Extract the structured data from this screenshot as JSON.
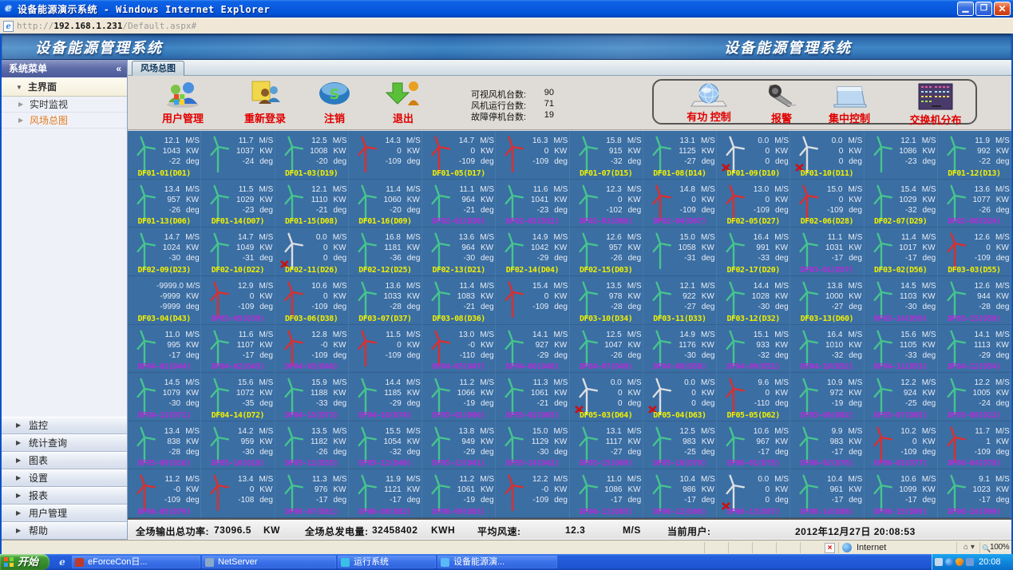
{
  "window": {
    "title": "设备能源演示系统 - Windows Internet Explorer",
    "url_prefix": "http://",
    "url_host": "192.168.1.231",
    "url_path": "/Default.aspx#",
    "minimize": "_",
    "restore": "❐",
    "close": "✕"
  },
  "banner": {
    "left_title": "设备能源管理系统",
    "right_title": "设备能源管理系统"
  },
  "sidebar": {
    "header": "系统菜单",
    "collapse": "«",
    "main_item": "主界面",
    "sub_items": [
      {
        "label": "实时监视",
        "highlight": false
      },
      {
        "label": "风场总图",
        "highlight": true
      }
    ],
    "accordion": [
      "监控",
      "统计查询",
      "图表",
      "设置",
      "报表",
      "用户管理",
      "帮助"
    ]
  },
  "tab": "风场总图",
  "toolbar": {
    "buttons": [
      {
        "label": "用户管理",
        "icon": "users"
      },
      {
        "label": "重新登录",
        "icon": "relogin"
      },
      {
        "label": "注销",
        "icon": "logout"
      },
      {
        "label": "退出",
        "icon": "exit"
      }
    ],
    "stats": [
      {
        "label": "可视风机台数:",
        "value": "90"
      },
      {
        "label": "风机运行台数:",
        "value": "71"
      },
      {
        "label": "故障停机台数:",
        "value": "19"
      }
    ],
    "controls": [
      {
        "label": "有功 控制",
        "icon": "globe"
      },
      {
        "label": "报警",
        "icon": "speaker"
      },
      {
        "label": "集中控制",
        "icon": "panel"
      },
      {
        "label": "交换机分布",
        "icon": "switch"
      }
    ]
  },
  "grid": {
    "units": {
      "speed": "M/S",
      "power": "KW",
      "deg": "deg"
    },
    "colors": {
      "background": "#3b6ea3",
      "label_yellow": "#f0ef00",
      "label_magenta": "#d02fd0",
      "turbine_green": "#46c48e",
      "turbine_red": "#d83030",
      "turbine_white": "#dcdfe3"
    },
    "rows": [
      [
        [
          "12.1",
          "1043",
          "-22",
          "DF01-01(D01)",
          "g",
          "y"
        ],
        [
          "11.7",
          "1037",
          "-24",
          "",
          "g",
          "y"
        ],
        [
          "12.5",
          "1008",
          "-20",
          "DF01-03(D19)",
          "g",
          "y"
        ],
        [
          "14.3",
          "0",
          "-109",
          "",
          "r",
          "y"
        ],
        [
          "14.7",
          "0",
          "-109",
          "DF01-05(D17)",
          "r",
          "y"
        ],
        [
          "16.3",
          "0",
          "-109",
          "",
          "r",
          "y"
        ],
        [
          "15.8",
          "915",
          "-32",
          "DF01-07(D15)",
          "g",
          "y"
        ],
        [
          "13.1",
          "1125",
          "-27",
          "DF01-08(D14)",
          "g",
          "y"
        ],
        [
          "0.0",
          "0",
          "0",
          "DF01-09(D10)",
          "x",
          "y"
        ],
        [
          "0.0",
          "0",
          "0",
          "DF01-10(D11)",
          "x",
          "y"
        ],
        [
          "12.1",
          "1086",
          "-23",
          "",
          "g",
          "y"
        ],
        [
          "11.9",
          "992",
          "-22",
          "DF01-12(D13)",
          "g",
          "y"
        ]
      ],
      [
        [
          "13.4",
          "957",
          "-26",
          "DF01-13(D06)",
          "g",
          "y"
        ],
        [
          "11.5",
          "1029",
          "-23",
          "DF01-14(D07)",
          "g",
          "y"
        ],
        [
          "12.1",
          "1110",
          "-21",
          "DF01-15(D08)",
          "g",
          "y"
        ],
        [
          "11.4",
          "1060",
          "-20",
          "DF01-16(D09)",
          "g",
          "y"
        ],
        [
          "11.1",
          "964",
          "-21",
          "DF02-01(D30)",
          "g",
          "m"
        ],
        [
          "11.6",
          "1041",
          "-23",
          "DF02-02(D31)",
          "g",
          "m"
        ],
        [
          "12.3",
          "0",
          "-102",
          "DF02-03(D68)",
          "g",
          "m"
        ],
        [
          "14.8",
          "0",
          "-109",
          "DF02-04(D67)",
          "r",
          "m"
        ],
        [
          "13.0",
          "0",
          "-109",
          "DF02-05(D27)",
          "r",
          "y"
        ],
        [
          "15.0",
          "0",
          "-109",
          "DF02-06(D28)",
          "r",
          "y"
        ],
        [
          "15.4",
          "1029",
          "-32",
          "DF02-07(D29)",
          "g",
          "y"
        ],
        [
          "13.6",
          "1077",
          "-26",
          "DF02-08(D24)",
          "g",
          "m"
        ]
      ],
      [
        [
          "14.7",
          "1024",
          "-30",
          "DF02-09(D23)",
          "g",
          "y"
        ],
        [
          "14.7",
          "1049",
          "-31",
          "DF02-10(D22)",
          "g",
          "y"
        ],
        [
          "0.0",
          "0",
          "0",
          "DF02-11(D26)",
          "x",
          "y"
        ],
        [
          "16.8",
          "1181",
          "-36",
          "DF02-12(D25)",
          "g",
          "y"
        ],
        [
          "13.6",
          "964",
          "-30",
          "DF02-13(D21)",
          "g",
          "y"
        ],
        [
          "14.9",
          "1042",
          "-29",
          "DF02-14(D04)",
          "g",
          "y"
        ],
        [
          "12.6",
          "957",
          "-26",
          "DF02-15(D03)",
          "g",
          "y"
        ],
        [
          "15.0",
          "1058",
          "-31",
          "",
          "g",
          "y"
        ],
        [
          "16.4",
          "991",
          "-33",
          "DF02-17(D20)",
          "g",
          "y"
        ],
        [
          "11.1",
          "1031",
          "-17",
          "DF03-01(D57)",
          "g",
          "m"
        ],
        [
          "11.4",
          "1017",
          "-17",
          "DF03-02(D56)",
          "g",
          "y"
        ],
        [
          "12.6",
          "0",
          "-109",
          "DF03-03(D55)",
          "r",
          "y"
        ]
      ],
      [
        [
          "-9999.0",
          "-9999",
          "-9999",
          "DF03-04(D43)",
          "n",
          "y"
        ],
        [
          "12.9",
          "0",
          "-109",
          "DF03-05(D39)",
          "r",
          "m"
        ],
        [
          "10.6",
          "0",
          "-109",
          "DF03-06(D38)",
          "r",
          "y"
        ],
        [
          "13.6",
          "1033",
          "-28",
          "DF03-07(D37)",
          "g",
          "y"
        ],
        [
          "11.4",
          "1083",
          "-21",
          "DF03-08(D36)",
          "g",
          "y"
        ],
        [
          "15.4",
          "0",
          "-109",
          "",
          "r",
          "y"
        ],
        [
          "13.5",
          "978",
          "-28",
          "DF03-10(D34)",
          "g",
          "y"
        ],
        [
          "12.1",
          "922",
          "-27",
          "DF03-11(D33)",
          "g",
          "y"
        ],
        [
          "14.4",
          "1028",
          "-30",
          "DF03-12(D32)",
          "g",
          "y"
        ],
        [
          "13.8",
          "1000",
          "-27",
          "DF03-13(D60)",
          "g",
          "y"
        ],
        [
          "14.5",
          "1103",
          "-30",
          "DF03-14(D59)",
          "g",
          "m"
        ],
        [
          "12.6",
          "944",
          "-28",
          "DF03-15(D58)",
          "g",
          "m"
        ]
      ],
      [
        [
          "11.0",
          "995",
          "-17",
          "DF04-01(D44)",
          "g",
          "m"
        ],
        [
          "11.6",
          "1107",
          "-17",
          "DF04-02(D45)",
          "g",
          "m"
        ],
        [
          "12.8",
          "-0",
          "-109",
          "DF04-03(D46)",
          "r",
          "m"
        ],
        [
          "11.5",
          "0",
          "-109",
          "",
          "r",
          "m"
        ],
        [
          "13.0",
          "-0",
          "-110",
          "DF04-05(D47)",
          "r",
          "m"
        ],
        [
          "14.1",
          "927",
          "-29",
          "DF04-06(D48)",
          "g",
          "m"
        ],
        [
          "12.5",
          "1047",
          "-26",
          "DF04-07(D49)",
          "g",
          "m"
        ],
        [
          "14.9",
          "1176",
          "-30",
          "DF04-08(D50)",
          "g",
          "m"
        ],
        [
          "15.1",
          "933",
          "-32",
          "DF04-09(D51)",
          "g",
          "m"
        ],
        [
          "16.4",
          "1010",
          "-32",
          "DF04-10(D52)",
          "g",
          "m"
        ],
        [
          "15.6",
          "1105",
          "-33",
          "DF04-11(D53)",
          "g",
          "m"
        ],
        [
          "14.1",
          "1113",
          "-29",
          "DF04-12(D54)",
          "g",
          "m"
        ]
      ],
      [
        [
          "14.5",
          "1079",
          "-30",
          "DF04-13(D71)",
          "g",
          "m"
        ],
        [
          "15.6",
          "1072",
          "-35",
          "DF04-14(D72)",
          "g",
          "y"
        ],
        [
          "15.9",
          "1188",
          "-33",
          "DF04-15(D73)",
          "g",
          "m"
        ],
        [
          "14.4",
          "1185",
          "-29",
          "DF04-16(D74)",
          "g",
          "m"
        ],
        [
          "11.2",
          "1066",
          "-19",
          "DF05-01(D66)",
          "g",
          "m"
        ],
        [
          "11.3",
          "1061",
          "-21",
          "DF05-02(D65)",
          "g",
          "m"
        ],
        [
          "0.0",
          "0",
          "0",
          "DF05-03(D64)",
          "x",
          "y"
        ],
        [
          "0.0",
          "0",
          "0",
          "DF05-04(D63)",
          "x",
          "y"
        ],
        [
          "9.6",
          "0",
          "-110",
          "DF05-05(D62)",
          "r",
          "y"
        ],
        [
          "10.9",
          "972",
          "-19",
          "DF05-06(D02)",
          "g",
          "m"
        ],
        [
          "12.2",
          "924",
          "-25",
          "DF05-07(D05)",
          "g",
          "m"
        ],
        [
          "12.2",
          "1005",
          "-24",
          "DF05-08(D12)",
          "g",
          "m"
        ]
      ],
      [
        [
          "13.4",
          "838",
          "-28",
          "DF05-09(D16)",
          "g",
          "m"
        ],
        [
          "14.2",
          "959",
          "-30",
          "DF05-10(D18)",
          "g",
          "m"
        ],
        [
          "13.5",
          "1182",
          "-26",
          "DF05-11(D35)",
          "g",
          "m"
        ],
        [
          "15.5",
          "1054",
          "-32",
          "DF05-12(D40)",
          "g",
          "m"
        ],
        [
          "13.8",
          "949",
          "-29",
          "DF05-13(D41)",
          "g",
          "m"
        ],
        [
          "15.0",
          "1129",
          "-30",
          "DF05-14(D42)",
          "g",
          "m"
        ],
        [
          "13.1",
          "1117",
          "-27",
          "DF05-15(D69)",
          "g",
          "m"
        ],
        [
          "12.5",
          "983",
          "-25",
          "DF05-16(D70)",
          "g",
          "m"
        ],
        [
          "10.6",
          "967",
          "-17",
          "DF06-01(D75)",
          "g",
          "m"
        ],
        [
          "9.9",
          "983",
          "-17",
          "DF06-02(D76)",
          "g",
          "m"
        ],
        [
          "10.2",
          "0",
          "-109",
          "DF06-03(D77)",
          "r",
          "m"
        ],
        [
          "11.7",
          "1",
          "-109",
          "DF06-04(D78)",
          "r",
          "m"
        ]
      ],
      [
        [
          "11.2",
          "-0",
          "-109",
          "DF06-05(D79)",
          "r",
          "m"
        ],
        [
          "13.4",
          "0",
          "-108",
          "",
          "r",
          "m"
        ],
        [
          "11.3",
          "976",
          "-17",
          "DF06-07(D81)",
          "g",
          "m"
        ],
        [
          "11.9",
          "1121",
          "-17",
          "DF06-08(D82)",
          "g",
          "m"
        ],
        [
          "11.2",
          "1061",
          "-19",
          "DF06-09(D83)",
          "g",
          "m"
        ],
        [
          "12.2",
          "-0",
          "-109",
          "",
          "r",
          "m"
        ],
        [
          "11.0",
          "1086",
          "-17",
          "DF06-11(D85)",
          "g",
          "m"
        ],
        [
          "10.4",
          "986",
          "-17",
          "DF06-12(D86)",
          "g",
          "m"
        ],
        [
          "0.0",
          "0",
          "0",
          "DF06-13(D87)",
          "x",
          "m"
        ],
        [
          "10.4",
          "961",
          "-17",
          "DF06-14(D88)",
          "g",
          "m"
        ],
        [
          "10.6",
          "1099",
          "-17",
          "DF06-15(D89)",
          "g",
          "m"
        ],
        [
          "9.1",
          "1023",
          "-17",
          "DF06-16(D90)",
          "g",
          "m"
        ]
      ]
    ]
  },
  "summary": {
    "items": [
      "全场输出总功率:",
      "73096.5",
      "KW",
      "全场总发电量:",
      "32458402",
      "KWH",
      "平均风速:",
      "12.3",
      "M/S",
      "当前用户:",
      "2012年12月27日  20:08:53"
    ]
  },
  "statusbar": {
    "zone": "Internet",
    "zoom": "100%"
  },
  "taskbar": {
    "start": "开始",
    "quick": "e",
    "tasks": [
      {
        "label": "eForceCon日...",
        "color": "#c03a2a"
      },
      {
        "label": "NetServer",
        "color": "#8aa8c8"
      },
      {
        "label": "运行系统",
        "color": "#3ac0e8"
      },
      {
        "label": "设备能源演...",
        "color": "#58b8f8"
      }
    ],
    "time": "20:08"
  }
}
